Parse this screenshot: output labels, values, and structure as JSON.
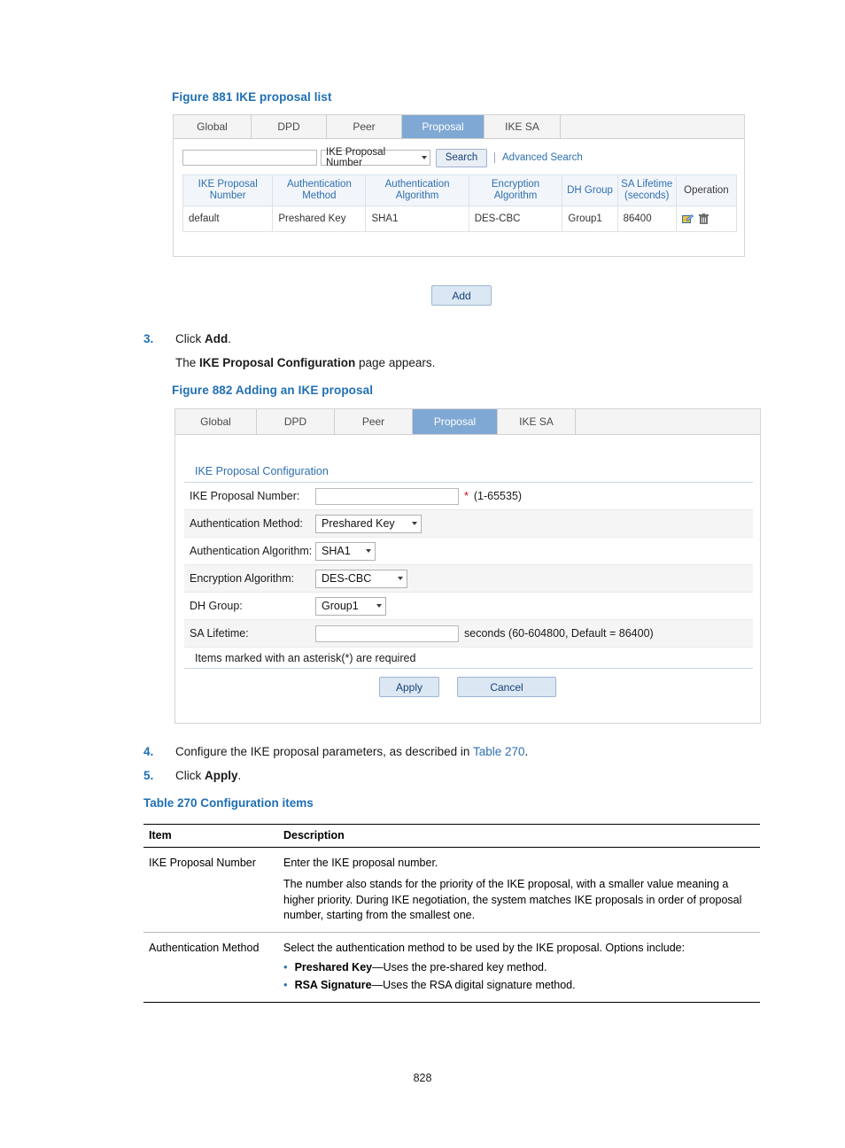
{
  "figure881": {
    "caption": "Figure 881 IKE proposal list",
    "tabs": [
      {
        "label": "Global",
        "active": false
      },
      {
        "label": "DPD",
        "active": false
      },
      {
        "label": "Peer",
        "active": false
      },
      {
        "label": "Proposal",
        "active": true
      },
      {
        "label": "IKE SA",
        "active": false
      }
    ],
    "search": {
      "input_value": "",
      "input_placeholder": "",
      "select_value": "IKE Proposal Number",
      "button_label": "Search",
      "advanced_label": "Advanced Search",
      "search_icon": "search-icon"
    },
    "table": {
      "headers": [
        "IKE Proposal Number",
        "Authentication Method",
        "Authentication Algorithm",
        "Encryption Algorithm",
        "DH Group",
        "SA Lifetime (seconds)",
        "Operation"
      ],
      "rows": [
        {
          "number": "default",
          "auth_method": "Preshared Key",
          "auth_algorithm": "SHA1",
          "enc_algorithm": "DES-CBC",
          "dh_group": "Group1",
          "sa_lifetime": "86400",
          "operations": [
            "edit-icon",
            "delete-icon"
          ]
        }
      ]
    },
    "add_button": "Add"
  },
  "steps": {
    "step3": {
      "num": "3.",
      "line1_prefix": "Click ",
      "line1_bold": "Add",
      "line1_suffix": ".",
      "line2_prefix": "The ",
      "line2_bold": "IKE Proposal Configuration",
      "line2_suffix": " page appears."
    },
    "step4": {
      "num": "4.",
      "text_prefix": "Configure the IKE proposal parameters, as described in ",
      "link": "Table 270",
      "text_suffix": "."
    },
    "step5": {
      "num": "5.",
      "text_prefix": "Click ",
      "bold": "Apply",
      "text_suffix": "."
    }
  },
  "figure882": {
    "caption": "Figure 882 Adding an IKE proposal",
    "tabs": [
      {
        "label": "Global",
        "active": false
      },
      {
        "label": "DPD",
        "active": false
      },
      {
        "label": "Peer",
        "active": false
      },
      {
        "label": "Proposal",
        "active": true
      },
      {
        "label": "IKE SA",
        "active": false
      }
    ],
    "form_title": "IKE Proposal Configuration",
    "fields": [
      {
        "label": "IKE Proposal Number:",
        "type": "text",
        "value": "",
        "required": "*",
        "hint": "(1-65535)"
      },
      {
        "label": "Authentication Method:",
        "type": "select",
        "value": "Preshared Key",
        "required": "",
        "hint": ""
      },
      {
        "label": "Authentication Algorithm:",
        "type": "select",
        "value": "SHA1",
        "required": "",
        "hint": ""
      },
      {
        "label": "Encryption Algorithm:",
        "type": "select",
        "value": "DES-CBC",
        "required": "",
        "hint": ""
      },
      {
        "label": "DH Group:",
        "type": "select",
        "value": "Group1",
        "required": "",
        "hint": ""
      },
      {
        "label": "SA Lifetime:",
        "type": "text",
        "value": "",
        "required": "",
        "hint": "seconds (60-604800, Default = 86400)"
      }
    ],
    "note": "Items marked with an asterisk(*) are required",
    "apply_label": "Apply",
    "cancel_label": "Cancel"
  },
  "table270": {
    "caption": "Table 270 Configuration items",
    "headers": [
      "Item",
      "Description"
    ],
    "rows": [
      {
        "item": "IKE Proposal Number",
        "desc_lines": [
          "Enter the IKE proposal number.",
          "The number also stands for the priority of the IKE proposal, with a smaller value meaning a higher priority. During IKE negotiation, the system matches IKE proposals in order of proposal number, starting from the smallest one."
        ],
        "bullets": []
      },
      {
        "item": "Authentication Method",
        "desc_lines": [
          "Select the authentication method to be used by the IKE proposal. Options include:"
        ],
        "bullets": [
          {
            "bold": "Preshared Key",
            "rest": "—Uses the pre-shared key method."
          },
          {
            "bold": "RSA Signature",
            "rest": "—Uses the RSA digital signature method."
          }
        ]
      }
    ]
  },
  "page_number": "828"
}
